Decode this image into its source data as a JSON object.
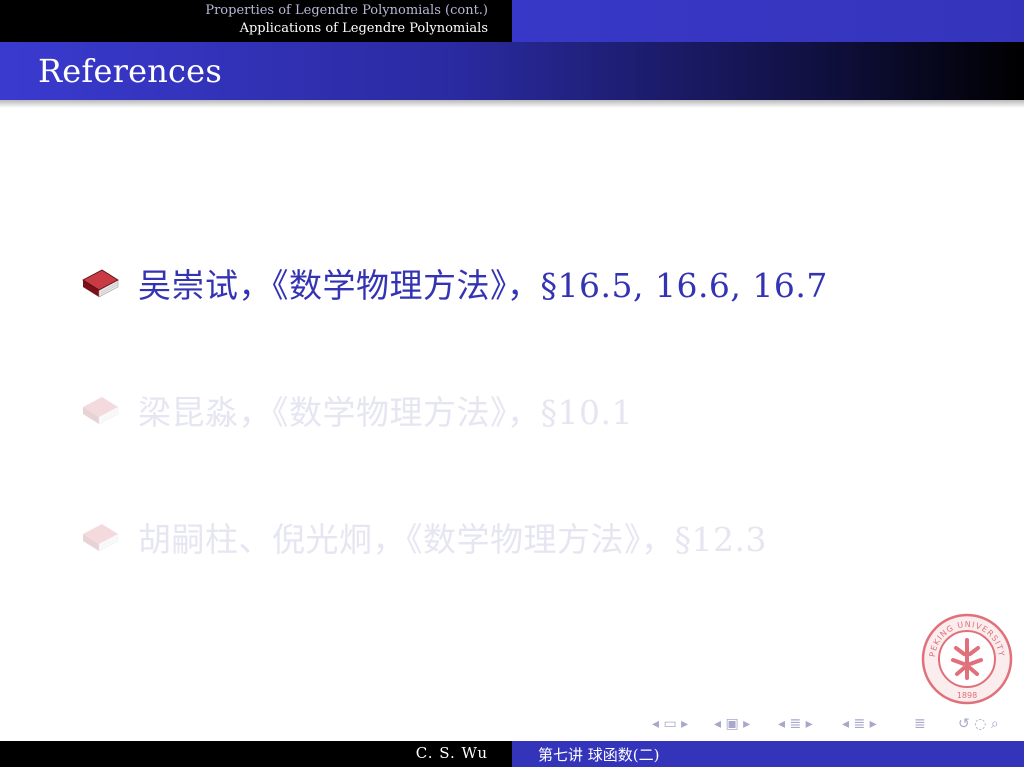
{
  "header": {
    "sections": [
      "Properties of Legendre Polynomials (cont.)",
      "Applications of Legendre Polynomials"
    ]
  },
  "frame": {
    "title": "References"
  },
  "references": [
    {
      "text": "吴崇试，《数学物理方法》，§16.5, 16.6, 16.7",
      "state": "active"
    },
    {
      "text": "梁昆淼，《数学物理方法》，§10.1",
      "state": "dimmed"
    },
    {
      "text": "胡嗣柱、倪光炯，《数学物理方法》，§12.3",
      "state": "dimmed"
    }
  ],
  "logo": {
    "text_top": "PEKING UNIVERSITY",
    "year": "1898",
    "color": "#e0707a"
  },
  "footer": {
    "author": "C. S. Wu",
    "title": "第七讲  球函数(二)"
  },
  "colors": {
    "accent": "#3333b3",
    "title_bar": "#2a2aa0",
    "dimmed_text": "#e6e6f2",
    "book": "#a8202a"
  },
  "icons": {
    "bullet": "book-icon",
    "nav": [
      "nav-frame-icon",
      "nav-subsection-icon",
      "nav-section-icon",
      "nav-document-icon",
      "nav-toc-icon",
      "nav-search-icon"
    ]
  }
}
